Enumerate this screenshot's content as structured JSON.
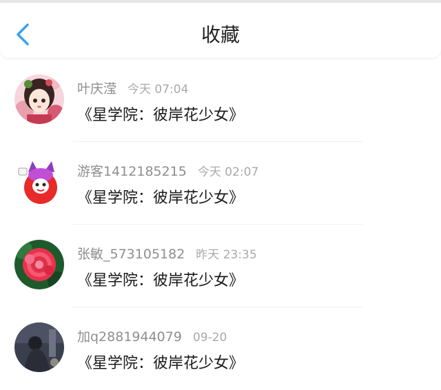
{
  "header": {
    "title": "收藏",
    "back_icon": "chevron-left-icon",
    "accent_color": "#3aa0f0"
  },
  "favorites": [
    {
      "username": "叶庆滢",
      "time": "今天 07:04",
      "book": "《星学院：彼岸花少女》"
    },
    {
      "username": "游客1412185215",
      "time": "今天 02:07",
      "book": "《星学院：彼岸花少女》"
    },
    {
      "username": "张敏_573105182",
      "time": "昨天 23:35",
      "book": "《星学院：彼岸花少女》"
    },
    {
      "username": "加q2881944079",
      "time": "09-20",
      "book": "《星学院：彼岸花少女》"
    }
  ]
}
